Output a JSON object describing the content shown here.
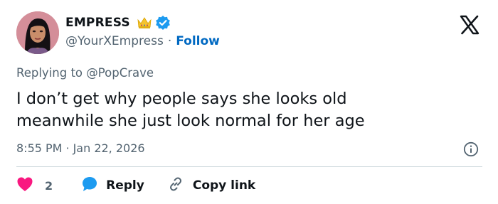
{
  "author": {
    "display_name": "EMPRESS",
    "handle": "@YourXEmpress",
    "separator": "·",
    "follow_label": "Follow"
  },
  "reply_context": "Replying to @PopCrave",
  "tweet": {
    "line1": "I don’t get why people says she looks old",
    "line2": "meanwhile she just look normal for her age"
  },
  "meta": {
    "time": "8:55 PM",
    "separator": "·",
    "date": "Jan 22, 2026"
  },
  "actions": {
    "like_count": "2",
    "reply_label": "Reply",
    "copy_link_label": "Copy link"
  },
  "colors": {
    "like": "#f91880",
    "reply": "#1d9bf0",
    "follow": "#0069c2",
    "verified": "#1d9bf0",
    "crown": "#f4c430"
  },
  "icons": {
    "crown": "crown-icon",
    "verified": "verified-badge-icon",
    "platform": "x-logo-icon",
    "info": "info-icon",
    "like": "heart-icon",
    "reply": "speech-bubble-icon",
    "copy": "link-icon"
  }
}
